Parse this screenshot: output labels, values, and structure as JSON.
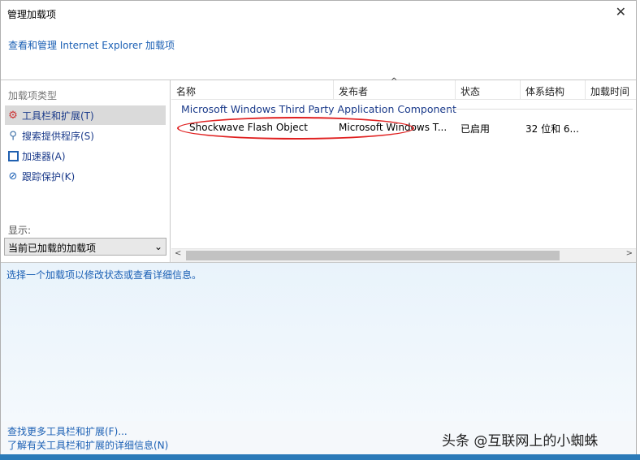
{
  "window": {
    "title": "管理加载项",
    "close": "✕",
    "subtitle_link": "查看和管理 Internet Explorer 加载项"
  },
  "sidebar": {
    "header": "加载项类型",
    "items": [
      {
        "label": "工具栏和扩展(T)",
        "icon": "gear-icon"
      },
      {
        "label": "搜索提供程序(S)",
        "icon": "search-icon"
      },
      {
        "label": "加速器(A)",
        "icon": "accelerator-icon"
      },
      {
        "label": "跟踪保护(K)",
        "icon": "block-icon"
      }
    ],
    "show_label": "显示:",
    "show_value": "当前已加载的加载项"
  },
  "list": {
    "columns": [
      "名称",
      "发布者",
      "状态",
      "体系结构",
      "加载时间"
    ],
    "group": "Microsoft Windows Third Party Application Component",
    "rows": [
      {
        "name": "Shockwave Flash Object",
        "publisher": "Microsoft Windows T...",
        "status": "已启用",
        "arch": "32 位和 6..."
      }
    ]
  },
  "detail": {
    "hint": "选择一个加载项以修改状态或查看详细信息。"
  },
  "footer": {
    "link1": "查找更多工具栏和扩展(F)...",
    "link2": "了解有关工具栏和扩展的详细信息(N)"
  },
  "watermark": "头条 @互联网上的小蜘蛛"
}
